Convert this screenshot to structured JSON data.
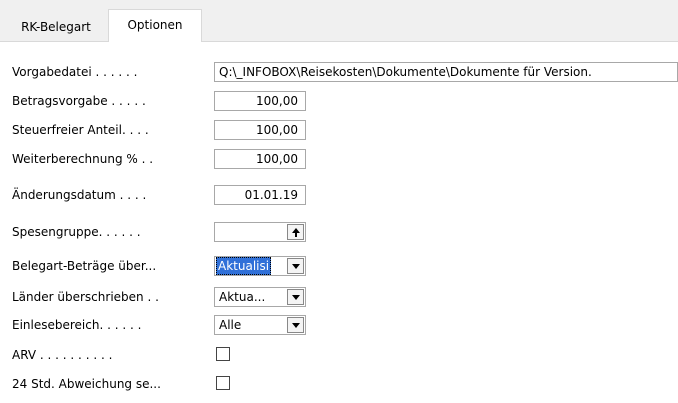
{
  "tabs": [
    {
      "label": "RK-Belegart",
      "active": false
    },
    {
      "label": "Optionen",
      "active": true
    }
  ],
  "rows": {
    "vorgabedatei": {
      "label": "Vorgabedatei . . . . . .",
      "value": "Q:\\_INFOBOX\\Reisekosten\\Dokumente\\Dokumente für Version."
    },
    "betragsvorgabe": {
      "label": "Betragsvorgabe . . . . .",
      "value": "100,00"
    },
    "steuerfreier": {
      "label": "Steuerfreier Anteil. . . .",
      "value": "100,00"
    },
    "weiterberechnung": {
      "label": "Weiterberechnung % . .",
      "value": "100,00"
    },
    "aenderungsdatum": {
      "label": "Änderungsdatum . . . .",
      "value": "01.01.19"
    },
    "spesengruppe": {
      "label": "Spesengruppe. . . . . .",
      "value": ""
    },
    "belegart_betraege": {
      "label": "Belegart-Beträge über...",
      "value": "Aktualisi"
    },
    "laender": {
      "label": "Länder überschrieben . .",
      "value": "Aktua..."
    },
    "einlesebereich": {
      "label": "Einlesebereich. . . . . .",
      "value": "Alle"
    },
    "arv": {
      "label": "ARV . . . . . . . . . .",
      "checked": false
    },
    "abweichung": {
      "label": "24 Std. Abweichung se...",
      "checked": false
    }
  },
  "colors": {
    "selection": "#3070d8",
    "tab_bg": "#f0f0f0"
  }
}
